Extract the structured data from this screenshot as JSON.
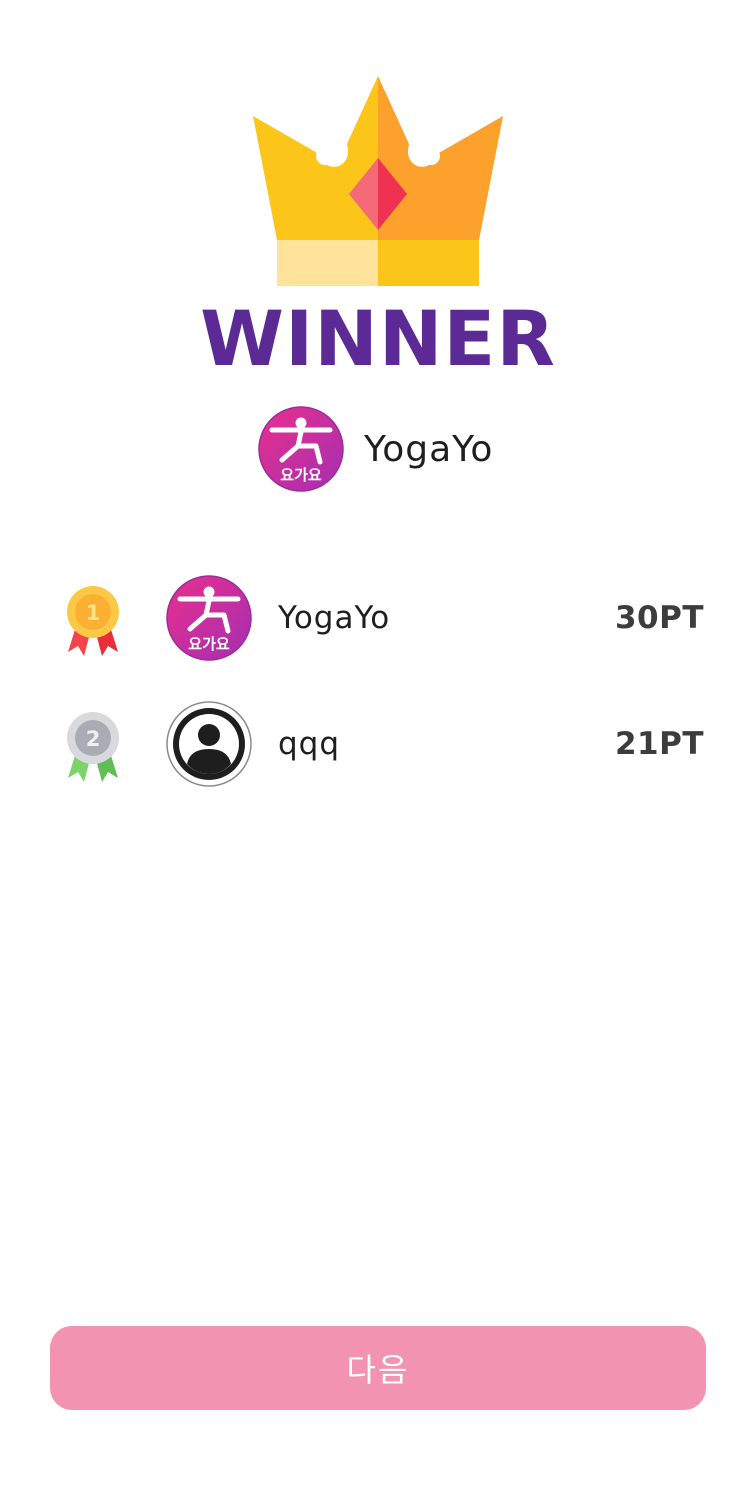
{
  "header": {
    "icon": "crown-icon",
    "title": "WINNER",
    "title_color": "#5b2a94",
    "winner_name": "YogaYo",
    "winner_avatar_text": "요가요"
  },
  "ranking": [
    {
      "rank": "1",
      "medal": "gold-medal-icon",
      "avatar_text": "요가요",
      "name": "YogaYo",
      "score": "30PT"
    },
    {
      "rank": "2",
      "medal": "silver-medal-icon",
      "avatar_text": "",
      "name": "qqq",
      "score": "21PT"
    }
  ],
  "footer": {
    "next_label": "다음",
    "button_color": "#f293b1"
  }
}
